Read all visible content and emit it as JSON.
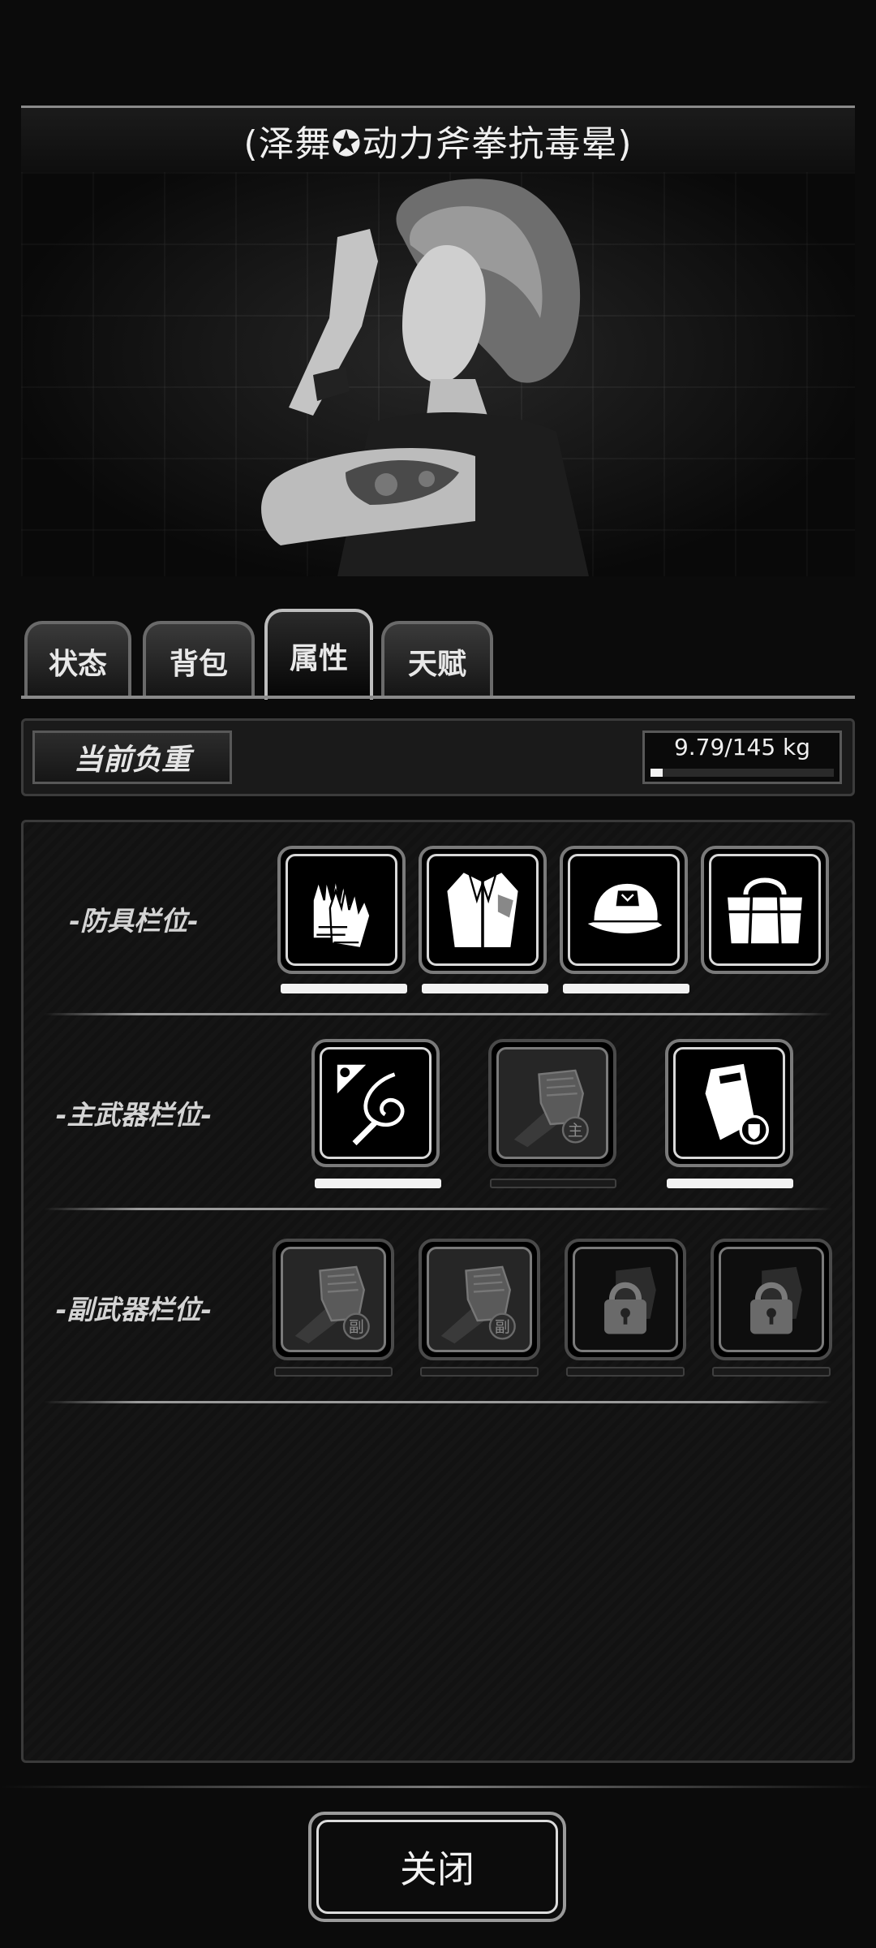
{
  "title": "(泽舞✪动力斧拳抗毒晕)",
  "tabs": [
    {
      "label": "状态",
      "active": false
    },
    {
      "label": "背包",
      "active": false
    },
    {
      "label": "属性",
      "active": true
    },
    {
      "label": "天赋",
      "active": false
    }
  ],
  "load": {
    "label": "当前负重",
    "value": "9.79/145 kg",
    "fraction": 0.0675
  },
  "sections": {
    "armor": {
      "label": "-防具栏位-",
      "slots": [
        {
          "icon": "gloves-icon",
          "filled": true
        },
        {
          "icon": "jacket-icon",
          "filled": true
        },
        {
          "icon": "cap-icon",
          "filled": true
        },
        {
          "icon": "bag-icon",
          "filled": true
        }
      ]
    },
    "primary": {
      "label": "-主武器栏位-",
      "slots": [
        {
          "icon": "whip-icon",
          "filled": true
        },
        {
          "icon": "fist-icon",
          "filled": false,
          "badge": "主"
        },
        {
          "icon": "riot-shield-icon",
          "filled": true
        }
      ]
    },
    "secondary": {
      "label": "-副武器栏位-",
      "slots": [
        {
          "icon": "fist-icon",
          "filled": false,
          "badge": "副"
        },
        {
          "icon": "fist-icon",
          "filled": false,
          "badge": "副"
        },
        {
          "icon": "lock-icon",
          "filled": false,
          "locked": true
        },
        {
          "icon": "lock-icon",
          "filled": false,
          "locked": true
        }
      ]
    }
  },
  "footer": {
    "close_label": "关闭"
  }
}
